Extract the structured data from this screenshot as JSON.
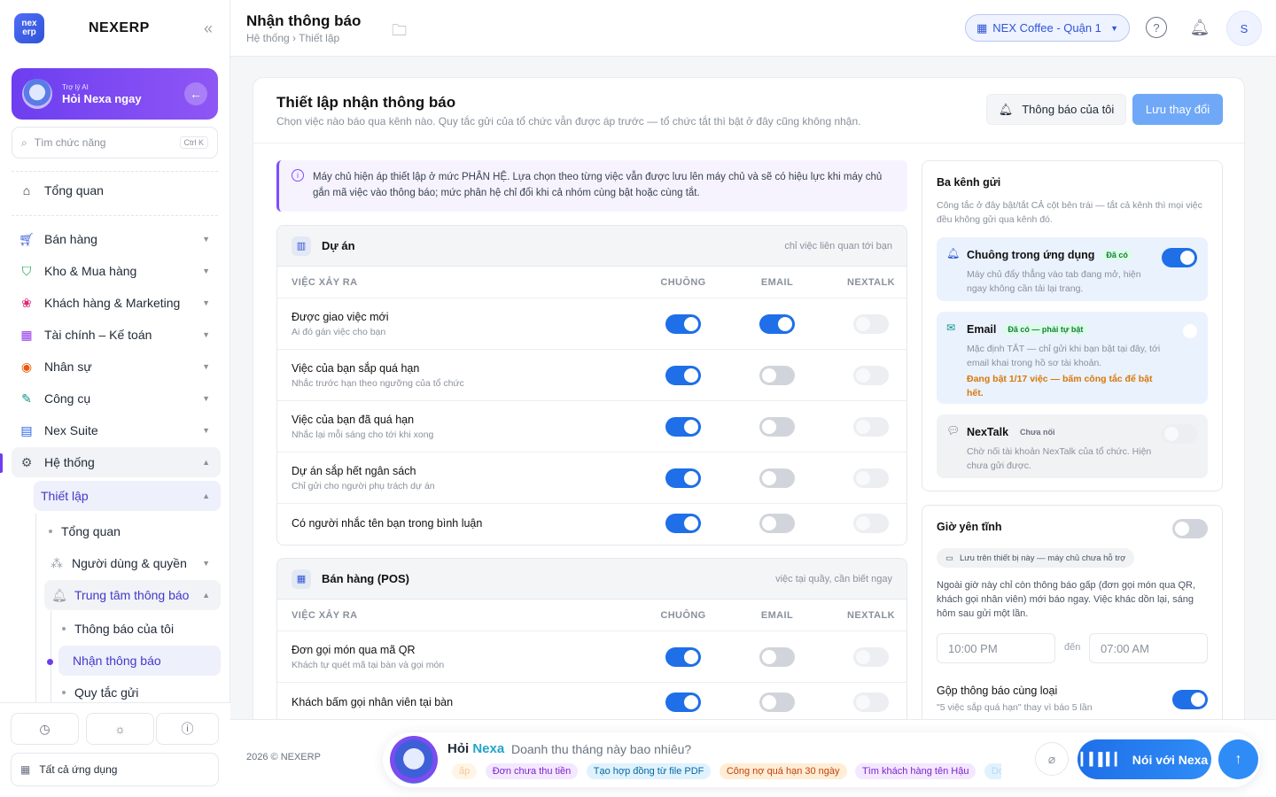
{
  "brand": {
    "name": "NEXERP",
    "logo_top": "nex",
    "logo_bottom": "erp",
    "collapse_icon": "«"
  },
  "ai_card": {
    "small": "Trợ lý AI",
    "big": "Hỏi Nexa ngay"
  },
  "side_search": {
    "placeholder": "Tìm chức năng",
    "shortcut": "Ctrl K"
  },
  "sidebar": {
    "overview": "Tổng quan",
    "items": [
      {
        "label": "Bán hàng",
        "icon": "cart-icon"
      },
      {
        "label": "Kho & Mua hàng",
        "icon": "bag-icon"
      },
      {
        "label": "Khách hàng & Marketing",
        "icon": "people-icon"
      },
      {
        "label": "Tài chính – Kế toán",
        "icon": "calculator-icon"
      },
      {
        "label": "Nhân sự",
        "icon": "user-icon"
      },
      {
        "label": "Công cụ",
        "icon": "wrench-icon"
      },
      {
        "label": "Nex Suite",
        "icon": "document-icon"
      },
      {
        "label": "Hệ thống",
        "icon": "gear-icon"
      }
    ],
    "setup": "Thiết lập",
    "setup_children": [
      "Tổng quan",
      "Người dùng & quyền",
      "Trung tâm thông báo"
    ],
    "notif_children": [
      "Thông báo của tôi",
      "Nhận thông báo",
      "Quy tắc gửi"
    ],
    "all_apps": "Tất cả ứng dụng"
  },
  "header": {
    "title": "Nhận thông báo",
    "breadcrumb": "Hệ thống › Thiết lập",
    "store": "NEX Coffee - Quận 1",
    "avatar": "S"
  },
  "card": {
    "title": "Thiết lập nhận thông báo",
    "subtitle": "Chọn việc nào báo qua kênh nào. Quy tắc gửi của tổ chức vẫn được áp trước — tổ chức tắt thì bật ở đây cũng không nhận.",
    "btn_mine": "Thông báo của tôi",
    "btn_save": "Lưu thay đổi",
    "notice": "Máy chủ hiện áp thiết lập ở mức PHÂN HỆ. Lựa chọn theo từng việc vẫn được lưu lên máy chủ và sẽ có hiệu lực khi máy chủ gắn mã việc vào thông báo; mức phân hệ chỉ đổi khi cả nhóm cùng bật hoặc cùng tắt."
  },
  "columns": {
    "event": "VIỆC XẢY RA",
    "bell": "CHUÔNG",
    "email": "EMAIL",
    "nextalk": "NEXTALK"
  },
  "groups": [
    {
      "title": "Dự án",
      "note": "chỉ việc liên quan tới bạn",
      "rows": [
        {
          "name": "Được giao việc mới",
          "desc": "Ai đó gán việc cho bạn",
          "bell": "on",
          "email": "on",
          "nextalk": "dis"
        },
        {
          "name": "Việc của bạn sắp quá hạn",
          "desc": "Nhắc trước hạn theo ngưỡng của tổ chức",
          "bell": "on",
          "email": "off",
          "nextalk": "dis"
        },
        {
          "name": "Việc của bạn đã quá hạn",
          "desc": "Nhắc lại mỗi sáng cho tới khi xong",
          "bell": "on",
          "email": "off",
          "nextalk": "dis"
        },
        {
          "name": "Dự án sắp hết ngân sách",
          "desc": "Chỉ gửi cho người phụ trách dự án",
          "bell": "on",
          "email": "off",
          "nextalk": "dis"
        },
        {
          "name": "Có người nhắc tên bạn trong bình luận",
          "desc": "",
          "bell": "on",
          "email": "off",
          "nextalk": "dis"
        }
      ]
    },
    {
      "title": "Bán hàng (POS)",
      "note": "việc tại quầy, cần biết ngay",
      "rows": [
        {
          "name": "Đơn gọi món qua mã QR",
          "desc": "Khách tự quét mã tại bàn và gọi món",
          "bell": "on",
          "email": "off",
          "nextalk": "dis"
        },
        {
          "name": "Khách bấm gọi nhân viên tại bàn",
          "desc": "",
          "bell": "on",
          "email": "off",
          "nextalk": "dis"
        }
      ]
    }
  ],
  "channels_panel": {
    "title": "Ba kênh gửi",
    "desc": "Công tắc ở đây bật/tắt CẢ cột bên trái — tắt cả kênh thì mọi việc đều không gửi qua kênh đó.",
    "bell": {
      "name": "Chuông trong ứng dụng",
      "badge": "Đã có",
      "desc": "Máy chủ đẩy thẳng vào tab đang mở, hiện ngay không cần tải lại trang."
    },
    "email": {
      "name": "Email",
      "badge": "Đã có — phải tự bật",
      "desc": "Mặc định TẮT — chỉ gửi khi bạn bật tại đây, tới email khai trong hồ sơ tài khoản.",
      "warn": "Đang bật 1/17 việc — bấm công tắc để bật hết."
    },
    "nextalk": {
      "name": "NexTalk",
      "badge": "Chưa nối",
      "desc": "Chờ nối tài khoản NexTalk của tổ chức. Hiện chưa gửi được."
    }
  },
  "quiet_panel": {
    "title": "Giờ yên tĩnh",
    "pill": "Lưu trên thiết bị này — máy chủ chưa hỗ trợ",
    "desc": "Ngoài giờ này chỉ còn thông báo gấp (đơn gọi món qua QR, khách gọi nhân viên) mới báo ngay. Việc khác dồn lại, sáng hôm sau gửi một lần.",
    "from": "10:00 PM",
    "to_label": "đến",
    "to": "07:00 AM",
    "merge_title": "Gộp thông báo cùng loại",
    "merge_desc": "\"5 việc sắp quá hạn\" thay vì báo 5 lần"
  },
  "footer": {
    "copy": "2026 © NEXERP",
    "ask_prefix": "Hỏi",
    "ask_nexa": "Nexa",
    "placeholder": "Doanh thu tháng này bao nhiêu?",
    "chips": [
      "ấp",
      "Đơn chưa thu tiền",
      "Tạo hợp đồng từ file PDF",
      "Công nợ quá hạn 30 ngày",
      "Tìm khách hàng tên Hậu",
      "Doa"
    ],
    "talk": "Nói với Nexa"
  },
  "colors": {
    "accent": "#1e6fe8",
    "purple": "#6d3ef0"
  }
}
